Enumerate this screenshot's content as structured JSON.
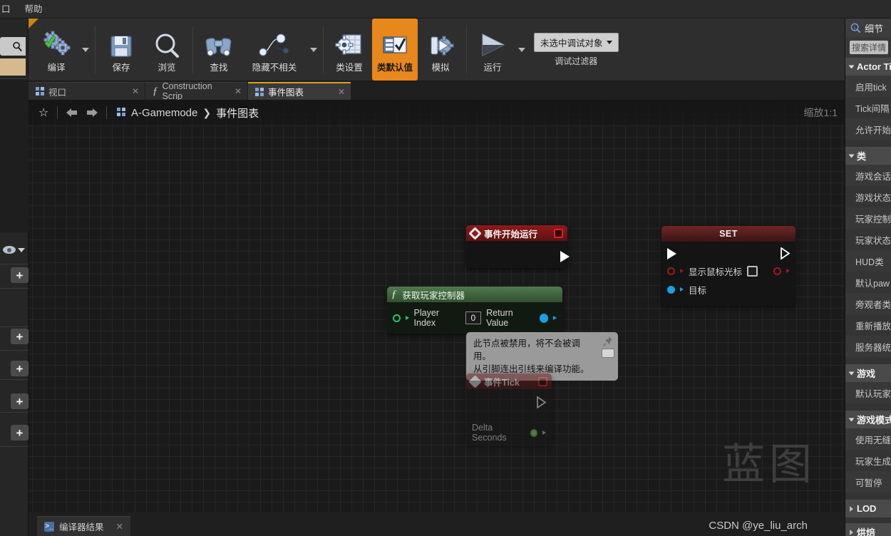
{
  "menubar": {
    "items": [
      "口",
      "帮助"
    ]
  },
  "toolbar": {
    "compile": {
      "label": "编译",
      "icon": "gear-check-icon"
    },
    "save": {
      "label": "保存",
      "icon": "floppy-disk-icon"
    },
    "browse": {
      "label": "浏览",
      "icon": "magnifier-icon"
    },
    "find": {
      "label": "查找",
      "icon": "binoculars-icon"
    },
    "hide_unrelated": {
      "label": "隐藏不相关",
      "icon": "node-graph-icon"
    },
    "class_settings": {
      "label": "类设置",
      "icon": "gear-window-icon"
    },
    "class_defaults": {
      "label": "类默认值",
      "icon": "checklist-icon",
      "active": true
    },
    "simulate": {
      "label": "模拟",
      "icon": "simulate-icon"
    },
    "play": {
      "label": "运行",
      "icon": "play-triangle-icon"
    },
    "debug_object": {
      "value": "未选中调试对象",
      "label": "调试过滤器"
    }
  },
  "tabs": [
    {
      "label": "视口",
      "icon": "viewport-grid-icon",
      "selected": false
    },
    {
      "label": "Construction Scrip",
      "icon": "function-f-icon",
      "selected": false
    },
    {
      "label": "事件图表",
      "icon": "graph-grid-icon",
      "selected": true
    }
  ],
  "breadcrumb": {
    "star_icon": "favorite-star-icon",
    "back_icon": "arrow-left-icon",
    "forward_icon": "arrow-right-icon",
    "graph_icon": "graph-grid-icon",
    "root": "A-Gamemode",
    "separator": "❯",
    "leaf": "事件图表"
  },
  "graph": {
    "zoom_label": "缩放1:1",
    "watermark": "蓝图",
    "nodes": {
      "event_begin_play": {
        "title": "事件开始运行",
        "breakpoint_icon": "red-square-icon"
      },
      "set_node": {
        "title": "SET",
        "bool_pin_label": "显示鼠标光标",
        "bool_value": false,
        "target_pin_label": "目标"
      },
      "get_player_controller": {
        "title": "获取玩家控制器",
        "input_label": "Player Index",
        "input_value": "0",
        "output_label": "Return Value"
      },
      "event_tick": {
        "title": "事件Tick",
        "delta_label": "Delta Seconds"
      }
    },
    "tooltip": {
      "line1": "此节点被禁用，将不会被调用。",
      "line2": "从引脚连出引线来编译功能。"
    }
  },
  "bottom": {
    "tab_label": "编译器结果",
    "tab_icon": "terminal-icon",
    "watermark": "CSDN @ye_liu_arch"
  },
  "details": {
    "title": "细节",
    "title_icon": "details-magnifier-icon",
    "search_placeholder": "搜索详情",
    "sections": [
      {
        "name": "Actor Ti",
        "collapsed": false,
        "rows": [
          "启用tick",
          "Tick间隔",
          "允许开始"
        ]
      },
      {
        "name": "类",
        "collapsed": false,
        "rows": [
          "游戏会话",
          "游戏状态",
          "玩家控制",
          "玩家状态",
          "HUD类",
          "默认paw",
          "旁观者类",
          "重新播放",
          "服务器统"
        ]
      },
      {
        "name": "游戏",
        "collapsed": false,
        "rows": [
          "默认玩家"
        ]
      },
      {
        "name": "游戏模式",
        "collapsed": false,
        "rows": [
          "使用无缝",
          "玩家生成",
          "可暂停"
        ]
      },
      {
        "name": "LOD",
        "collapsed": true,
        "rows": []
      },
      {
        "name": "烘焙",
        "collapsed": true,
        "rows": []
      }
    ]
  },
  "colors": {
    "accent_orange": "#e8871b",
    "exec_wire": "#ffffff",
    "data_wire_blue": "#18a0e8",
    "event_red": "#8d1a1a",
    "function_green": "#4e7a4e"
  }
}
